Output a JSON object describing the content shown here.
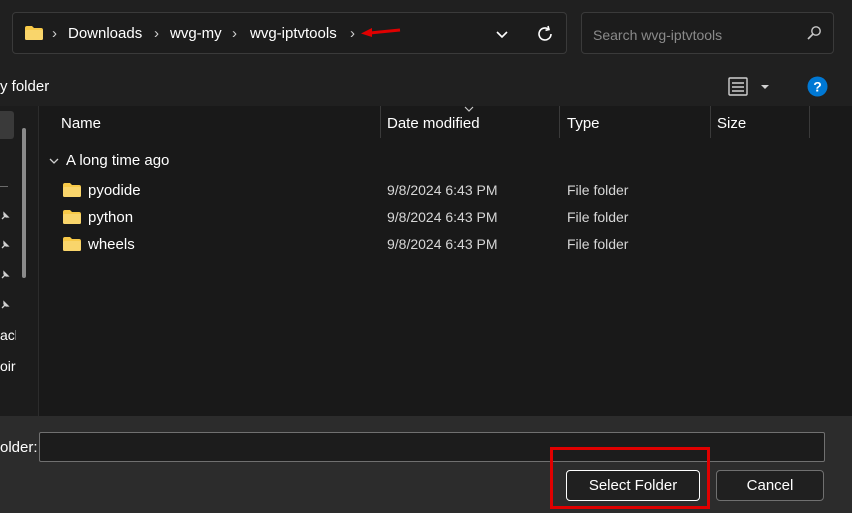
{
  "address_bar": {
    "breadcrumbs": [
      "Downloads",
      "wvg-my",
      "wvg-iptvtools"
    ]
  },
  "search": {
    "placeholder": "Search wvg-iptvtools"
  },
  "command_bar": {
    "new_folder_label": "y folder"
  },
  "nav_pane": {
    "partial_labels": [
      "ack",
      "oir"
    ]
  },
  "columns": [
    "Name",
    "Date modified",
    "Type",
    "Size"
  ],
  "group": {
    "label": "A long time ago"
  },
  "files": [
    {
      "name": "pyodide",
      "date_modified": "9/8/2024 6:43 PM",
      "type": "File folder"
    },
    {
      "name": "python",
      "date_modified": "9/8/2024 6:43 PM",
      "type": "File folder"
    },
    {
      "name": "wheels",
      "date_modified": "9/8/2024 6:43 PM",
      "type": "File folder"
    }
  ],
  "bottom": {
    "folder_label": "older:",
    "folder_value": "",
    "select_button": "Select Folder",
    "cancel_button": "Cancel"
  },
  "colors": {
    "folder_icon": "#f7c948",
    "annotation_red": "#e00000",
    "help_blue": "#0078d4"
  },
  "icons": [
    "folder-icon",
    "chevron-right-icon",
    "chevron-down-icon",
    "refresh-icon",
    "search-icon",
    "view-options-icon",
    "help-icon",
    "pin-icon",
    "red-arrow-annotation"
  ]
}
